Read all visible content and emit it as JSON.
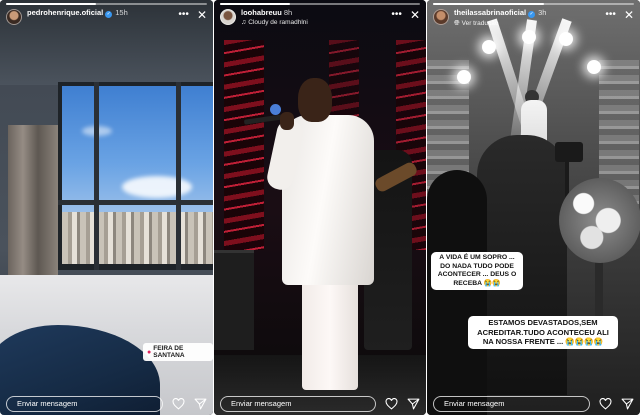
{
  "stories": [
    {
      "username": "pedrohenrique.oficial",
      "time": "15h",
      "progress_fraction": 0.45,
      "location_sticker": "FEIRA DE SANTANA",
      "reply_placeholder": "Enviar mensagem"
    },
    {
      "username": "loohabreuu",
      "time": "8h",
      "music_line": "Cloudy de ramadhlni",
      "progress_fraction": 0.35,
      "reply_placeholder": "Enviar mensagem"
    },
    {
      "username": "theilassabrinaoficial",
      "time": "3h",
      "translate_label": "Ver tradução",
      "progress_fraction": 0.55,
      "captions": [
        "A VIDA É UM SOPRO ... DO NADA TUDO PODE ACONTECER ... DEUS O RECEBA 😭😭",
        "ESTAMOS DEVASTADOS,SEM ACREDITAR.TUDO ACONTECEU ALI NA NOSSA FRENTE ... 😭😭😭😭"
      ],
      "reply_placeholder": "Enviar mensagem"
    }
  ],
  "icons": {
    "more": "more-horizontal-icon",
    "close": "close-icon",
    "like": "heart-icon",
    "share": "send-icon",
    "verified": "verified-badge-icon",
    "location": "location-pin-icon",
    "music": "music-note-icon",
    "translate": "translate-icon"
  },
  "colors": {
    "verified_blue": "#3897f0",
    "location_pin": "#e0245e"
  }
}
